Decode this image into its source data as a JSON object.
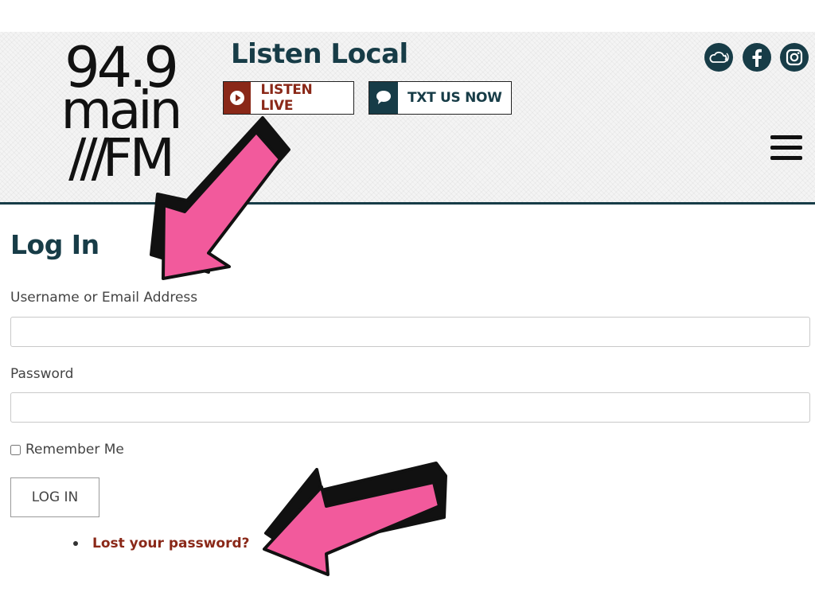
{
  "header": {
    "logo": {
      "line1": "94.9",
      "line2": "main",
      "line3_slashes": "///",
      "line3_text": "FM"
    },
    "tagline": "Listen Local",
    "buttons": {
      "listen_live": "LISTEN LIVE",
      "txt_us_now": "TXT US NOW"
    },
    "social_icons": [
      "soundcloud-icon",
      "facebook-icon",
      "instagram-icon"
    ],
    "menu_icon": "hamburger-menu-icon"
  },
  "login": {
    "title": "Log In",
    "username_label": "Username or Email Address",
    "username_value": "",
    "password_label": "Password",
    "password_value": "",
    "remember_label": "Remember Me",
    "remember_checked": false,
    "submit_label": "LOG IN",
    "lost_password_link": "Lost your password?"
  },
  "colors": {
    "brand_teal": "#173c47",
    "brand_red": "#8a2818",
    "arrow_pink": "#f25a9c"
  }
}
